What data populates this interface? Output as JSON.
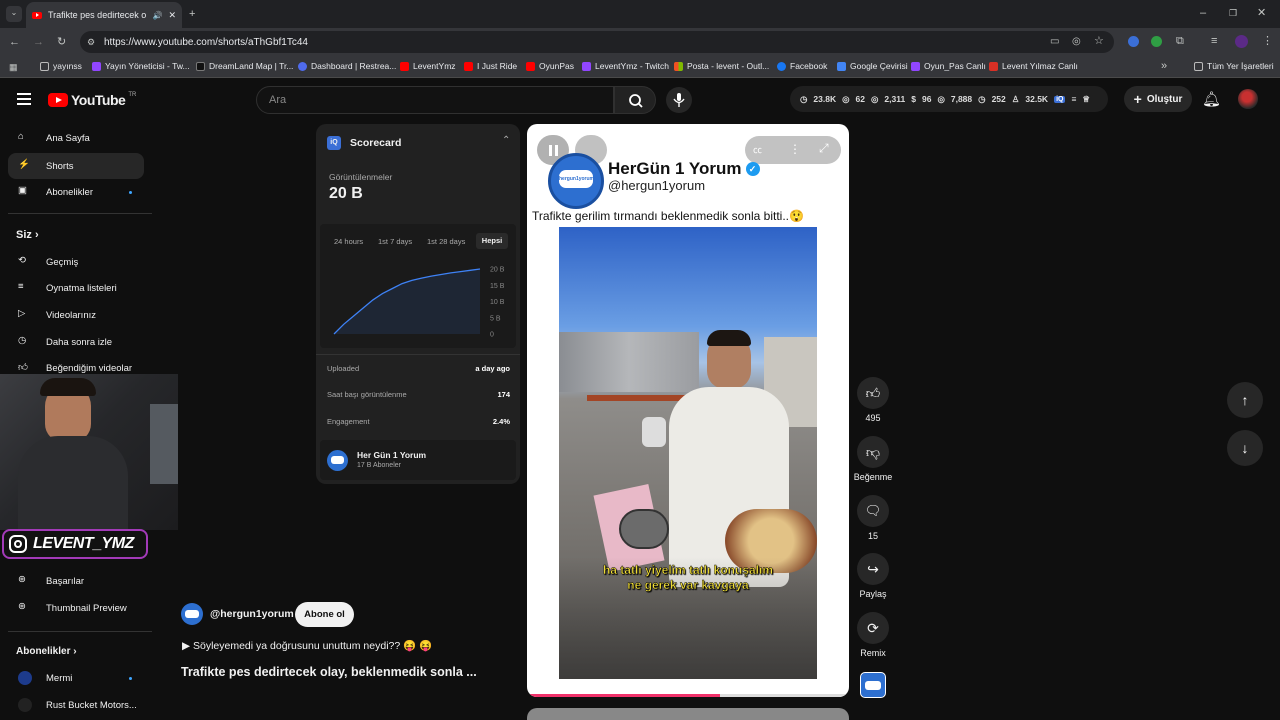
{
  "browser": {
    "tab_title": "Trafikte pes dedirtecek olay",
    "url": "https://www.youtube.com/shorts/aThGbf1Tc44",
    "bookmarks": [
      "yayınss",
      "Yayın Yöneticisi - Tw...",
      "DreamLand Map | Tr...",
      "Dashboard | Restrea...",
      "LeventYmz",
      "I Just Ride",
      "OyunPas",
      "LeventYmz - Twitch",
      "Posta - levent - Outl...",
      "Facebook",
      "Google Çevirisi",
      "Oyun_Pas Canlı",
      "Levent Yılmaz Canlı"
    ],
    "all_bookmarks": "Tüm Yer İşaretleri"
  },
  "masthead": {
    "logo_text": "YouTube",
    "region": "TR",
    "search_placeholder": "Ara",
    "create_label": "Oluştur",
    "stats": [
      "23.8K",
      "62",
      "2,311",
      "96",
      "7,888",
      "252",
      "32.5K"
    ]
  },
  "sidebar": {
    "items": [
      "Ana Sayfa",
      "Shorts",
      "Abonelikler"
    ],
    "you_header": "Siz",
    "you_items": [
      "Geçmiş",
      "Oynatma listeleri",
      "Videolarınız",
      "Daha sonra izle",
      "Beğendiğim videolar"
    ],
    "extra_items": [
      "Başarılar",
      "Thumbnail Preview"
    ],
    "subs_header": "Abonelikler",
    "subs": [
      "Mermi",
      "Rust Bucket Motors..."
    ]
  },
  "overlay": {
    "instagram_handle": "LEVENT_YMZ"
  },
  "scorecard": {
    "title": "Scorecard",
    "views_label": "Görüntülenmeler",
    "views_value": "20 B",
    "ranges": [
      "24 hours",
      "1st 7 days",
      "1st 28 days",
      "Hepsi"
    ],
    "y_ticks": [
      "20 B",
      "15 B",
      "10 B",
      "5 B",
      "0"
    ],
    "rows": [
      {
        "k": "Uploaded",
        "v": "a day ago"
      },
      {
        "k": "Saat başı görüntülenme",
        "v": "174"
      },
      {
        "k": "Engagement",
        "v": "2.4%"
      }
    ],
    "channel_name": "Her Gün 1 Yorum",
    "channel_subs": "17 B Aboneler"
  },
  "chart_data": {
    "type": "line",
    "series": [
      {
        "values": [
          0,
          3,
          5.5,
          8,
          10.5,
          12.5,
          14,
          15.5,
          16.5,
          17.2,
          17.8,
          18.3,
          18.8,
          19.2,
          19.6,
          20
        ]
      }
    ],
    "ylim": [
      0,
      20
    ],
    "yticks": [
      "20 B",
      "15 B",
      "10 B",
      "5 B",
      "0"
    ],
    "grid": false
  },
  "video": {
    "channel_title": "HerGün 1 Yorum",
    "handle": "@hergun1yorum",
    "caption": "Trafikte gerilim tırmandı beklenmedik sonla bitti..😲",
    "subtitle_line1": "ha tatlı yiyelim tatlı konuşalım",
    "subtitle_line2": "ne gerek var kavgaya",
    "progress": 0.6
  },
  "below": {
    "handle": "@hergun1yorum",
    "subscribe": "Abone ol",
    "description": "▶ Söyleyemedi ya doğrusunu unuttum neydi?? 😝 😝",
    "title": "Trafikte pes dedirtecek olay, beklenmedik sonla ..."
  },
  "actions": {
    "likes": "495",
    "dislike": "Beğenme",
    "comments": "15",
    "share": "Paylaş",
    "remix": "Remix"
  }
}
